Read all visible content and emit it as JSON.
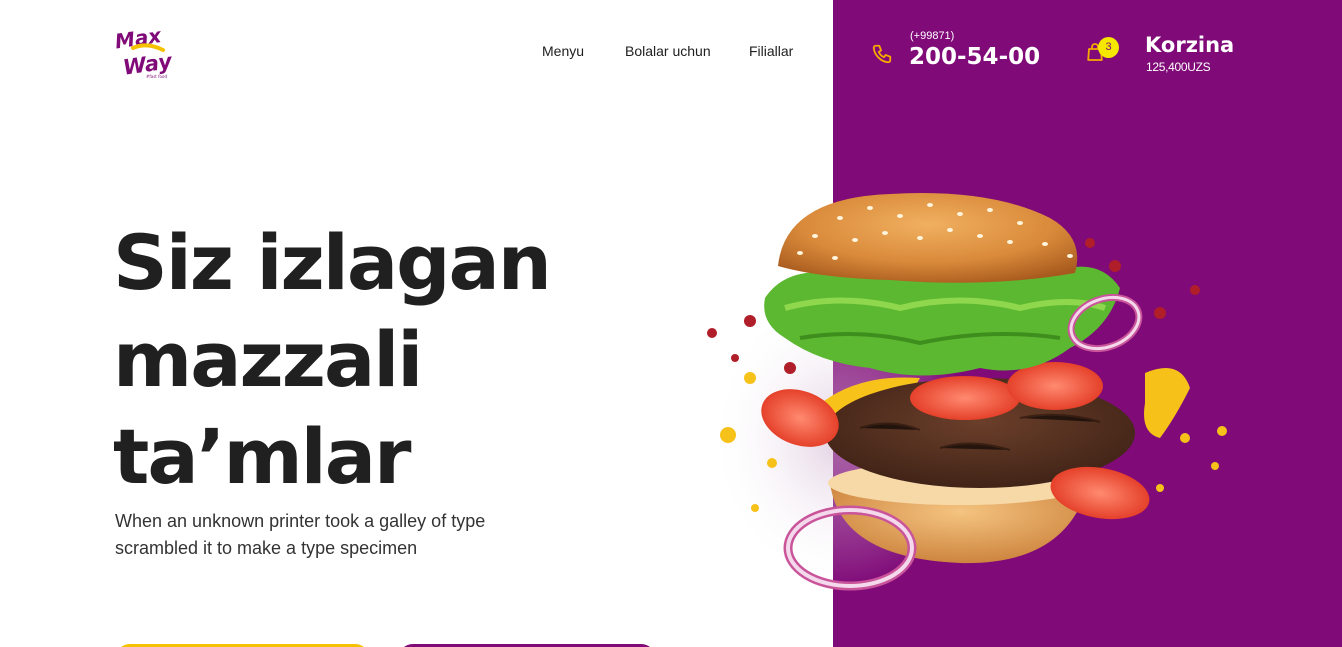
{
  "brand": {
    "name": "Max Way",
    "tagline": "#fast food"
  },
  "nav": {
    "items": [
      {
        "label": "Menyu"
      },
      {
        "label": "Bolalar uchun"
      },
      {
        "label": "Filiallar"
      }
    ]
  },
  "contact": {
    "phone_code": "(+99871)",
    "phone_number": "200-54-00",
    "icon": "phone-icon"
  },
  "cart": {
    "title": "Korzina",
    "total": "125,400UZS",
    "count": "3",
    "icon": "shopping-bag-icon"
  },
  "hero": {
    "title_lines": [
      "Siz izlagan",
      "mazzali",
      "ta’mlar"
    ],
    "subtitle": "When an unknown printer took a galley of type scrambled it to make a type specimen",
    "image": "burger-image"
  },
  "colors": {
    "brand_purple": "#7f0a78",
    "accent_yellow": "#f6c100",
    "badge_yellow": "#f6e700",
    "phone_icon": "#f6a800",
    "text_dark": "#202020"
  }
}
